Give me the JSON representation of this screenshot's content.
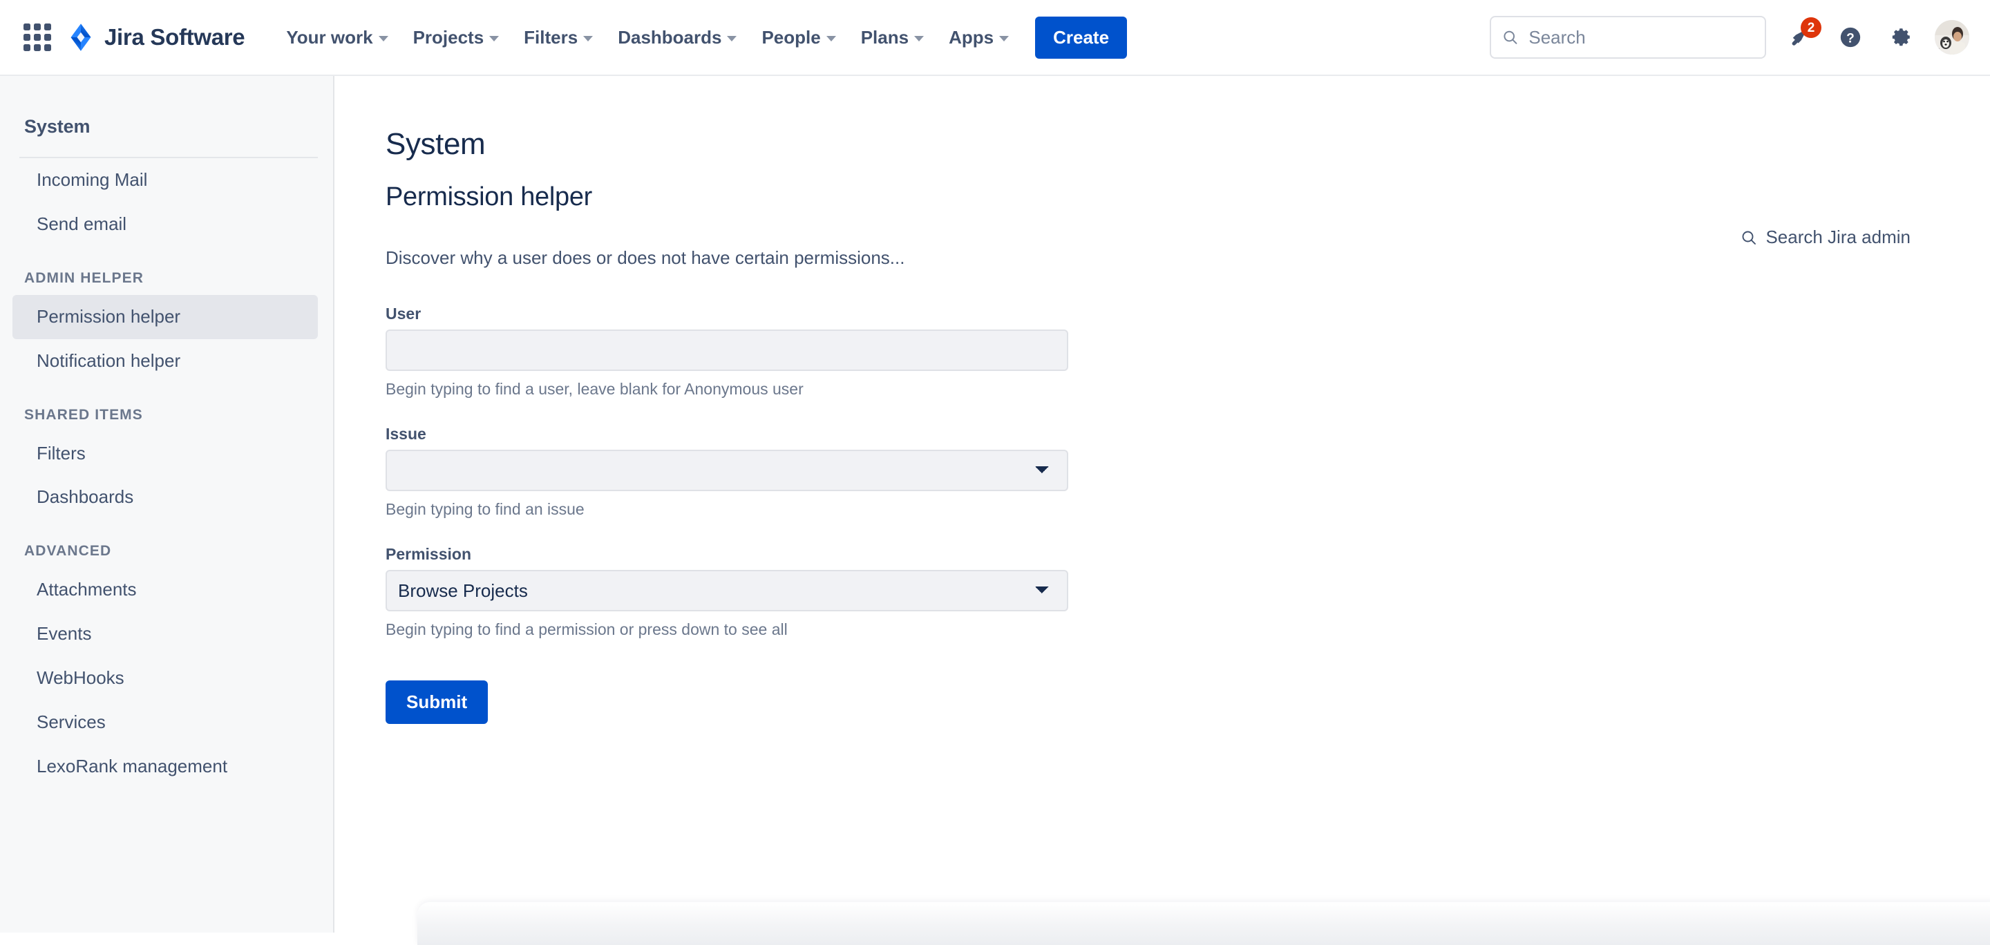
{
  "topnav": {
    "app_switcher_icon": "grid-apps-icon",
    "brand": {
      "logo_icon": "jira-logo-icon",
      "name": "Jira Software"
    },
    "items": [
      {
        "label": "Your work",
        "has_caret": true
      },
      {
        "label": "Projects",
        "has_caret": true
      },
      {
        "label": "Filters",
        "has_caret": true
      },
      {
        "label": "Dashboards",
        "has_caret": true
      },
      {
        "label": "People",
        "has_caret": true
      },
      {
        "label": "Plans",
        "has_caret": true
      },
      {
        "label": "Apps",
        "has_caret": true
      }
    ],
    "create_label": "Create",
    "search": {
      "placeholder": "Search",
      "value": "",
      "icon": "search-icon"
    },
    "notifications": {
      "icon": "megaphone-notification-icon",
      "badge_count": "2",
      "badge_color": "#de350b"
    },
    "help_icon": "help-question-icon",
    "settings_icon": "gear-settings-icon",
    "avatar_icon": "user-avatar"
  },
  "sidebar": {
    "title": "System",
    "items_top": [
      {
        "label": "Incoming Mail",
        "active": false
      },
      {
        "label": "Send email",
        "active": false
      }
    ],
    "sections": [
      {
        "heading": "ADMIN HELPER",
        "items": [
          {
            "label": "Permission helper",
            "active": true
          },
          {
            "label": "Notification helper",
            "active": false
          }
        ]
      },
      {
        "heading": "SHARED ITEMS",
        "items": [
          {
            "label": "Filters",
            "active": false
          },
          {
            "label": "Dashboards",
            "active": false
          }
        ]
      },
      {
        "heading": "ADVANCED",
        "items": [
          {
            "label": "Attachments",
            "active": false
          },
          {
            "label": "Events",
            "active": false
          },
          {
            "label": "WebHooks",
            "active": false
          },
          {
            "label": "Services",
            "active": false
          },
          {
            "label": "LexoRank management",
            "active": false
          }
        ]
      }
    ]
  },
  "main": {
    "page_title": "System",
    "page_subtitle": "Permission helper",
    "description": "Discover why a user does or does not have certain permissions...",
    "admin_search": {
      "label": "Search Jira admin",
      "icon": "search-icon"
    },
    "form": {
      "fields": [
        {
          "label": "User",
          "type": "text",
          "value": "",
          "placeholder": "",
          "hint": "Begin typing to find a user, leave blank for Anonymous user"
        },
        {
          "label": "Issue",
          "type": "select",
          "value": "",
          "options": [
            ""
          ],
          "hint": "Begin typing to find an issue"
        },
        {
          "label": "Permission",
          "type": "select",
          "value": "Browse Projects",
          "options": [
            "Browse Projects"
          ],
          "hint": "Begin typing to find a permission or press down to see all"
        }
      ],
      "submit_label": "Submit"
    }
  },
  "colors": {
    "brand_blue": "#0052cc",
    "jira_logo_blue": "#2684ff",
    "text_dark": "#172b4d",
    "text_muted": "#42526e",
    "text_subtle": "#6b778c",
    "sidebar_bg": "#f7f8f9",
    "active_item_bg": "#e4e6eb",
    "input_bg": "#f1f2f5",
    "badge_red": "#de350b"
  }
}
